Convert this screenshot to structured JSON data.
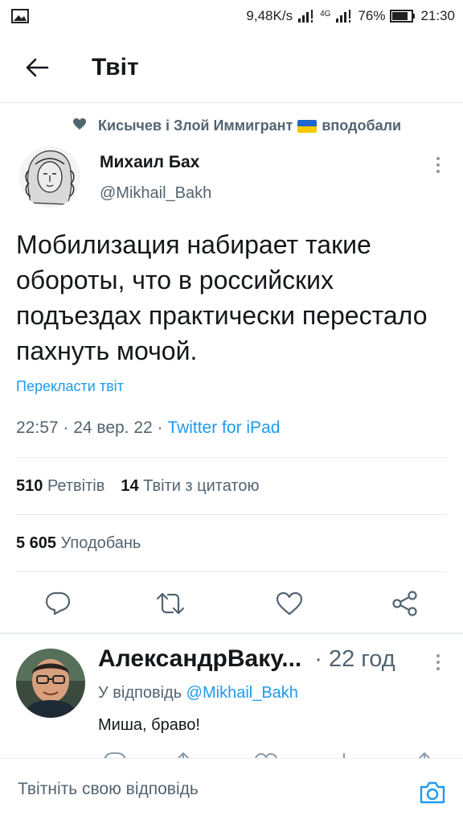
{
  "status_bar": {
    "speed": "9,48K/s",
    "network": "4G",
    "battery": "76%",
    "time": "21:30"
  },
  "header": {
    "title": "Твіт"
  },
  "social_context": {
    "before_flag": "Кисычев і Злой Иммигрант",
    "after_flag": "вподобали",
    "flag_colors": [
      "#1e66d0",
      "#f6c800"
    ]
  },
  "tweet": {
    "author_name": "Михаил Бах",
    "author_handle": "@Mikhail_Bakh",
    "text": "Мобилизация набирает такие обороты, что в российских подъездах практически перестало пахнуть мочой.",
    "translate": "Перекласти твіт",
    "time_date": "22:57 · 24 вер. 22 · ",
    "source": "Twitter for iPad",
    "retweets_count": "510",
    "retweets_label": "Ретвітів",
    "quotes_count": "14",
    "quotes_label": "Твіти з цитатою",
    "likes_count": "5 605",
    "likes_label": "Уподобань"
  },
  "reply": {
    "name": "АлександрВаку...",
    "time": "· 22 год",
    "reply_to_label": "У відповідь ",
    "reply_to_handle": "@Mikhail_Bakh",
    "text": "Миша, браво!"
  },
  "compose": {
    "placeholder": "Твітніть свою відповідь"
  },
  "colors": {
    "accent": "#1d9bf0",
    "text_primary": "#14171a",
    "text_secondary": "#536471"
  }
}
